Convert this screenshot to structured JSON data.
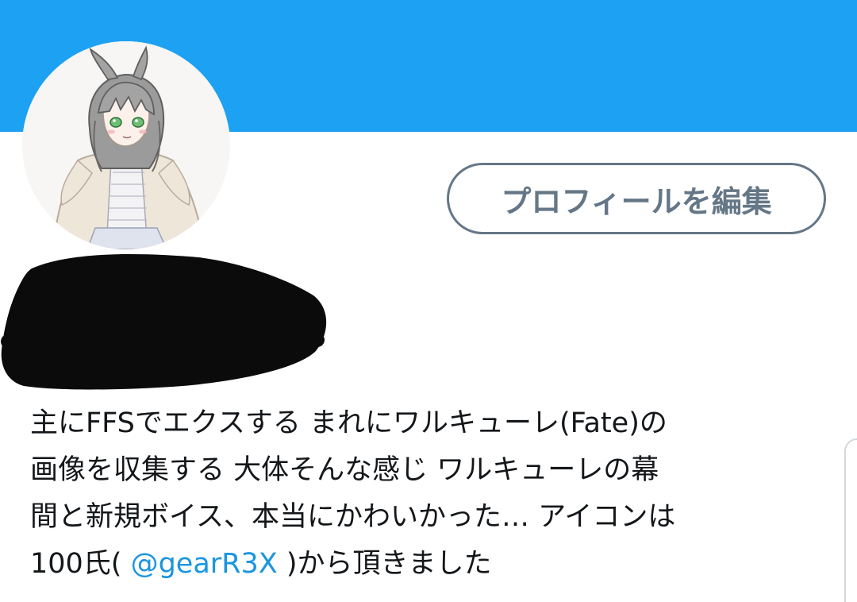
{
  "header": {
    "banner_color": "#1DA1F2"
  },
  "avatar": {
    "icon": "anime-character-avatar-icon"
  },
  "actions": {
    "edit_profile_label": "プロフィールを編集"
  },
  "profile": {
    "bio_line1": "主にFFSでエクスする まれにワルキューレ(Fate)の",
    "bio_line2": "画像を収集する 大体そんな感じ ワルキューレの幕",
    "bio_line3": "間と新規ボイス、本当にかわいかった… アイコンは",
    "bio_line4_prefix": "100氏( ",
    "bio_mention": "@gearR3X",
    "bio_line4_suffix": " )から頂きました"
  },
  "colors": {
    "accent": "#1DA1F2",
    "link": "#1B95E0",
    "secondary_text": "#657786",
    "primary_text": "#14171A"
  }
}
